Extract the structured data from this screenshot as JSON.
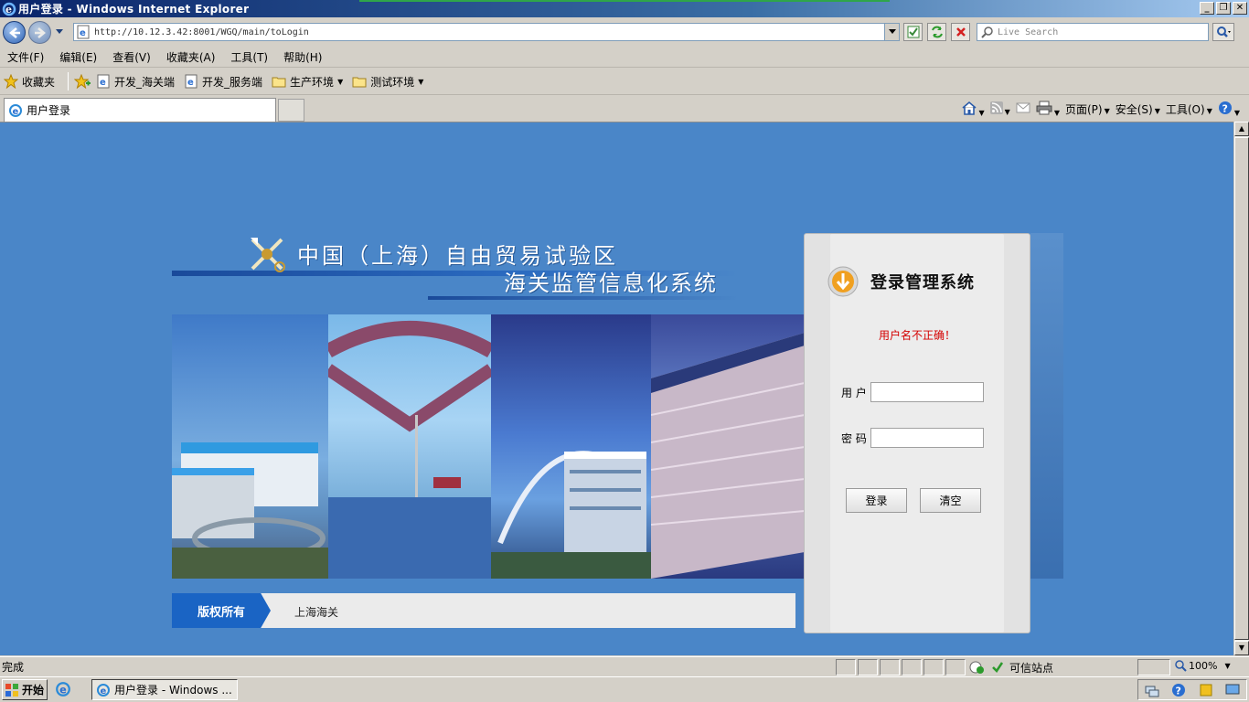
{
  "window": {
    "title": "用户登录 - Windows Internet Explorer",
    "min_glyph": "_",
    "max_glyph": "❐",
    "close_glyph": "✕"
  },
  "address": {
    "url": "http://10.12.3.42:8001/WGQ/main/toLogin",
    "search_placeholder": "Live Search"
  },
  "menu": {
    "items": [
      "文件(F)",
      "编辑(E)",
      "查看(V)",
      "收藏夹(A)",
      "工具(T)",
      "帮助(H)"
    ]
  },
  "favorites": {
    "label": "收藏夹",
    "items": [
      {
        "label": "开发_海关端",
        "icon": "ie-page-icon"
      },
      {
        "label": "开发_服务端",
        "icon": "ie-page-icon"
      },
      {
        "label": "生产环境",
        "icon": "folder-icon"
      },
      {
        "label": "测试环境",
        "icon": "folder-icon"
      }
    ]
  },
  "tab": {
    "label": "用户登录"
  },
  "command_bar": {
    "page_label": "页面(P)",
    "safety_label": "安全(S)",
    "tools_label": "工具(O)"
  },
  "page": {
    "logo_line1": "中国（上海）自由贸易试验区",
    "logo_line2": "海关监管信息化系统",
    "copyright_label": "版权所有",
    "copyright_org": "上海海关",
    "login": {
      "title": "登录管理系统",
      "error": "用户名不正确！",
      "user_label": "用 户",
      "user_value": "",
      "password_label": "密 码",
      "password_value": "",
      "login_button": "登录",
      "clear_button": "清空"
    }
  },
  "status": {
    "text": "完成",
    "zone": "可信站点",
    "zoom": "100%"
  },
  "taskbar": {
    "start": "开始",
    "task": "用户登录 - Windows ..."
  },
  "colors": {
    "page_background": "#4a86c8",
    "error_text": "#d40000",
    "copyright_label_bg": "#1a64c4"
  }
}
